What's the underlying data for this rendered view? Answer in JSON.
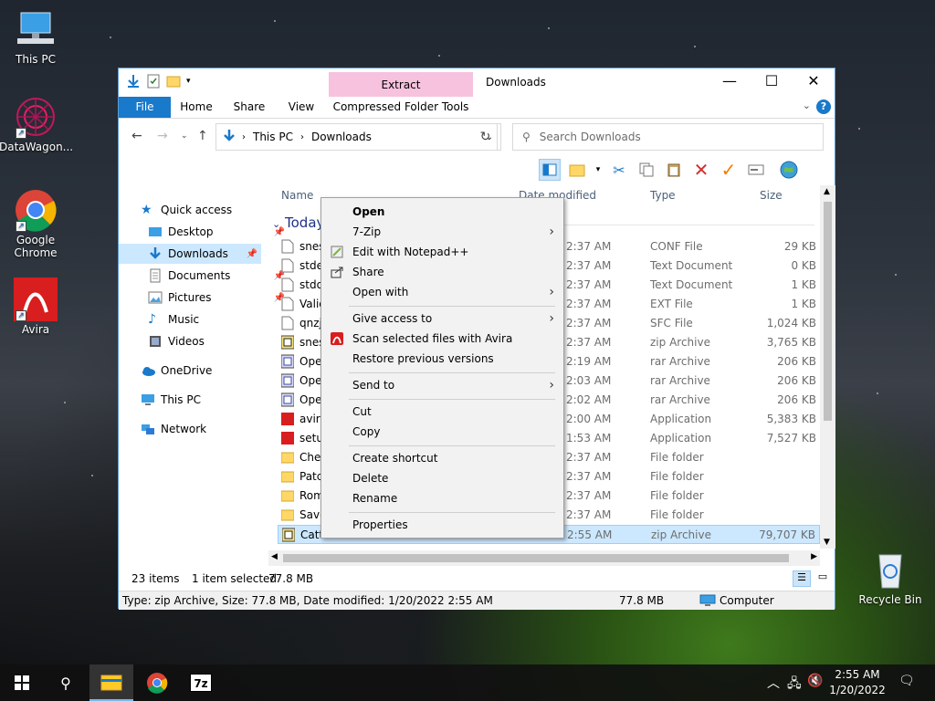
{
  "desktop": {
    "icons": [
      {
        "label": "This PC"
      },
      {
        "label": "DataWagon..."
      },
      {
        "label": "Google Chrome"
      },
      {
        "label": "Avira"
      },
      {
        "label": "Recycle Bin"
      }
    ]
  },
  "window": {
    "title": "Downloads",
    "context_tab": "Extract",
    "ribbon_tabs": [
      "File",
      "Home",
      "Share",
      "View",
      "Compressed Folder Tools"
    ],
    "address": {
      "crumbs": [
        "This PC",
        "Downloads"
      ]
    },
    "search_placeholder": "Search Downloads",
    "nav": {
      "quick_access": "Quick access",
      "items": [
        "Desktop",
        "Downloads",
        "Documents",
        "Pictures",
        "Music",
        "Videos"
      ],
      "onedrive": "OneDrive",
      "thispc": "This PC",
      "network": "Network"
    },
    "columns": {
      "name": "Name",
      "date": "Date modified",
      "type": "Type",
      "size": "Size"
    },
    "group_label": "Today",
    "files": [
      {
        "name": "snes",
        "date": "2:37 AM",
        "type": "CONF File",
        "size": "29 KB"
      },
      {
        "name": "stde",
        "date": "2:37 AM",
        "type": "Text Document",
        "size": "0 KB"
      },
      {
        "name": "stdo",
        "date": "2:37 AM",
        "type": "Text Document",
        "size": "1 KB"
      },
      {
        "name": "Valid",
        "date": "2:37 AM",
        "type": "EXT File",
        "size": "1 KB"
      },
      {
        "name": "qnzj",
        "date": "2:37 AM",
        "type": "SFC File",
        "size": "1,024 KB"
      },
      {
        "name": "snes",
        "date": "2:37 AM",
        "type": "zip Archive",
        "size": "3,765 KB"
      },
      {
        "name": "Ope",
        "date": "2:19 AM",
        "type": "rar Archive",
        "size": "206 KB"
      },
      {
        "name": "Ope",
        "date": "2:03 AM",
        "type": "rar Archive",
        "size": "206 KB"
      },
      {
        "name": "Ope",
        "date": "2:02 AM",
        "type": "rar Archive",
        "size": "206 KB"
      },
      {
        "name": "avira",
        "date": "2:00 AM",
        "type": "Application",
        "size": "5,383 KB"
      },
      {
        "name": "setu",
        "date": "1:53 AM",
        "type": "Application",
        "size": "7,527 KB"
      },
      {
        "name": "Chea",
        "date": "2:37 AM",
        "type": "File folder",
        "size": ""
      },
      {
        "name": "Patc",
        "date": "2:37 AM",
        "type": "File folder",
        "size": ""
      },
      {
        "name": "Rom",
        "date": "2:37 AM",
        "type": "File folder",
        "size": ""
      },
      {
        "name": "Save",
        "date": "2:37 AM",
        "type": "File folder",
        "size": ""
      },
      {
        "name": "Catt",
        "date": "2:55 AM",
        "type": "zip Archive",
        "size": "79,707 KB"
      }
    ],
    "status": {
      "count": "23 items",
      "selected": "1 item selected",
      "size": "77.8 MB"
    },
    "details": {
      "text": "Type: zip Archive, Size: 77.8 MB, Date modified: 1/20/2022 2:55 AM",
      "size": "77.8 MB",
      "location": "Computer"
    }
  },
  "context_menu": {
    "items": [
      {
        "label": "Open"
      },
      {
        "label": "7-Zip"
      },
      {
        "label": "Edit with Notepad++"
      },
      {
        "label": "Share"
      },
      {
        "label": "Open with"
      },
      {
        "label": "Give access to"
      },
      {
        "label": "Scan selected files with Avira"
      },
      {
        "label": "Restore previous versions"
      },
      {
        "label": "Send to"
      },
      {
        "label": "Cut"
      },
      {
        "label": "Copy"
      },
      {
        "label": "Create shortcut"
      },
      {
        "label": "Delete"
      },
      {
        "label": "Rename"
      },
      {
        "label": "Properties"
      }
    ]
  },
  "taskbar": {
    "time": "2:55 AM",
    "date": "1/20/2022",
    "sevenzip_label": "7z"
  }
}
